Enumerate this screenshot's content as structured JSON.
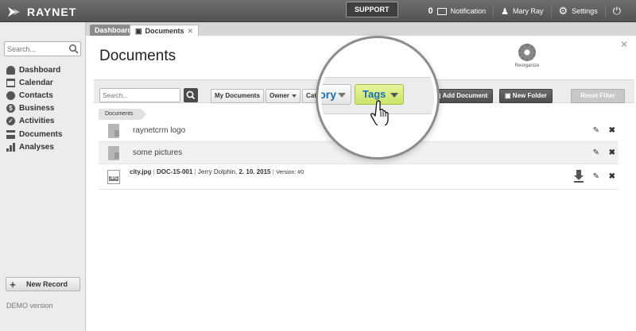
{
  "topbar": {
    "brand": "RAYNET",
    "support_label": "SUPPORT",
    "notification_count": "0",
    "notification_label": "Notification",
    "user_name": "Mary Ray",
    "settings_label": "Settings"
  },
  "sidebar": {
    "search_placeholder": "Search...",
    "items": [
      {
        "label": "Dashboard",
        "icon": "dashboard-icon"
      },
      {
        "label": "Calendar",
        "icon": "calendar-icon"
      },
      {
        "label": "Contacts",
        "icon": "contacts-icon"
      },
      {
        "label": "Business",
        "icon": "business-icon"
      },
      {
        "label": "Activities",
        "icon": "activities-icon"
      },
      {
        "label": "Documents",
        "icon": "documents-icon"
      },
      {
        "label": "Analyses",
        "icon": "analyses-icon"
      }
    ],
    "new_record_label": "New Record",
    "demo_label": "DEMO version"
  },
  "tabs": [
    {
      "label": "Dashboard",
      "active": false
    },
    {
      "label": "Documents",
      "active": true
    }
  ],
  "main": {
    "title": "Documents",
    "reorganize_label": "Reorganize",
    "filters": {
      "search_placeholder": "Search...",
      "my_documents_label": "My Documents",
      "owner_label": "Owner",
      "category_label": "Category",
      "tags_label": "Tags",
      "add_document_label": "Add Document",
      "new_folder_label": "New Folder",
      "reset_filter_label": "Reset Filter"
    },
    "breadcrumb": "Documents",
    "rows": [
      {
        "type": "folder",
        "name": "raynetcrm logo"
      },
      {
        "type": "folder",
        "name": "some pictures"
      },
      {
        "type": "file",
        "name": "city.jpg",
        "code": "DOC-15-001",
        "owner": "Jerry Dolphin,",
        "date": "2. 10. 2015",
        "version": "Version: #0",
        "ext": "JPG"
      }
    ]
  },
  "magnifier": {
    "category_fragment": "ory",
    "tags_label": "Tags"
  },
  "colors": {
    "topbar": "#5e5e5e",
    "tags_highlight": "#d6ea7c",
    "link_blue": "#1b6fb3"
  }
}
